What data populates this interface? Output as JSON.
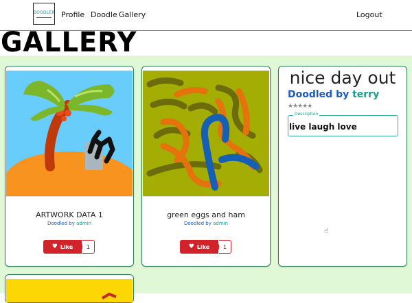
{
  "nav": {
    "logo_text": "DOODLER",
    "links": {
      "profile": "Profile",
      "doodle": "Doodle",
      "gallery": "Gallery"
    },
    "logout": "Logout"
  },
  "page": {
    "title": "GALLERY"
  },
  "cards": [
    {
      "title": "ARTWORK DATA 1",
      "doodled_prefix": "Doodled by",
      "user": "admin",
      "like_label": "Like",
      "like_count": "1"
    },
    {
      "title": "green eggs and ham",
      "doodled_prefix": "Doodled by",
      "user": "admin",
      "like_label": "Like",
      "like_count": "1"
    }
  ],
  "detail": {
    "title": "nice day out",
    "doodled_prefix": "Doodled by",
    "user": "terry",
    "rating_stars": "★★★★★",
    "description_label": "Description",
    "description_value": "live laugh love"
  },
  "colors": {
    "page_bg": "#e1f8d6",
    "accent_blue": "#1e5bbd",
    "accent_teal": "#1b9e8c",
    "like_red": "#d2232a"
  },
  "icons": {
    "heart": "heart-icon",
    "cursor": "cursor-icon"
  }
}
